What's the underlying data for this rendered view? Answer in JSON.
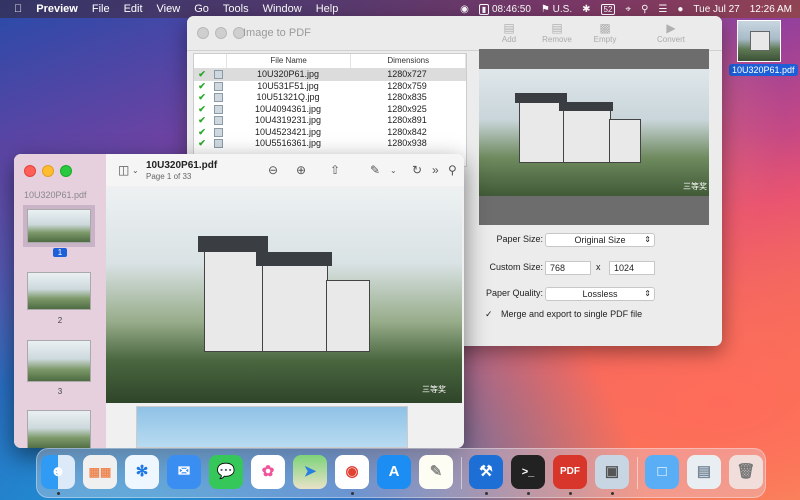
{
  "menubar": {
    "apple": "",
    "items": [
      "Preview",
      "File",
      "Edit",
      "View",
      "Go",
      "Tools",
      "Window",
      "Help"
    ],
    "battery_time": "08:46:50",
    "keyboard": "U.S.",
    "battery_badge": "52",
    "date": "Tue Jul 27",
    "time": "12:26 AM"
  },
  "desktop": {
    "file_label": "10U320P61.pdf"
  },
  "image_to_pdf": {
    "title": "Image to PDF",
    "toolbar": {
      "add": "Add",
      "remove": "Remove",
      "empty": "Empty",
      "convert": "Convert"
    },
    "columns": [
      "File Name",
      "Dimensions"
    ],
    "rows": [
      {
        "name": "10U320P61.jpg",
        "dim": "1280x727"
      },
      {
        "name": "10U531F51.jpg",
        "dim": "1280x759"
      },
      {
        "name": "10U51321Q.jpg",
        "dim": "1280x835"
      },
      {
        "name": "10U4094361.jpg",
        "dim": "1280x925"
      },
      {
        "name": "10U4319231.jpg",
        "dim": "1280x891"
      },
      {
        "name": "10U4523421.jpg",
        "dim": "1280x842"
      },
      {
        "name": "10U5516361.jpg",
        "dim": "1280x938"
      }
    ],
    "paper_size_label": "Paper Size:",
    "paper_size_value": "Original Size",
    "custom_size_label": "Custom Size:",
    "custom_w": "768",
    "custom_x": "x",
    "custom_h": "1024",
    "quality_label": "Paper Quality:",
    "quality_value": "Lossless",
    "merge_label": "Merge and export to single PDF file",
    "merge_checked": true,
    "watermark": "三等奖"
  },
  "preview": {
    "sidebar_title": "10U320P61.pdf",
    "doc_name": "10U320P61.pdf",
    "page_info": "Page 1 of 33",
    "pages": [
      "1",
      "2",
      "3"
    ],
    "watermark": "三等奖"
  },
  "dock": {
    "apps": [
      "Finder",
      "Launchpad",
      "Safari",
      "Mail",
      "Messages",
      "Photos",
      "Maps",
      "Chrome",
      "App Store",
      "TextEdit",
      "Xcode",
      "Terminal",
      "Image to PDF",
      "Preview",
      "Downloads",
      "Folder",
      "Trash"
    ]
  }
}
